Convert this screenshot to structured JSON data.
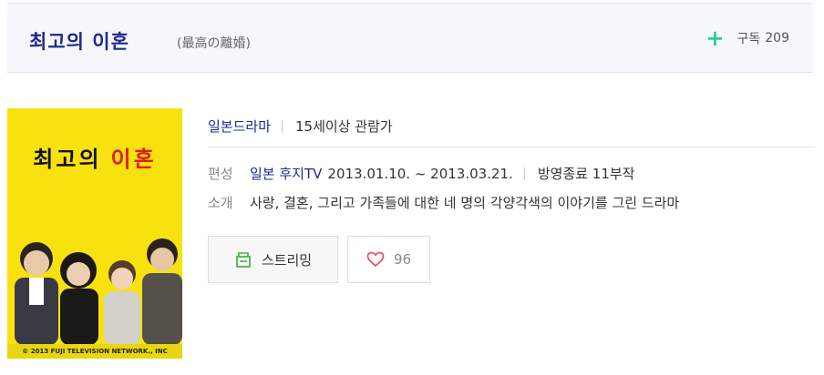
{
  "header": {
    "title": "최고의 이혼",
    "subtitle": "(最高の離婚)",
    "subscribe_label": "구독",
    "subscribe_count": "209"
  },
  "poster": {
    "title_part1": "최고의",
    "title_part2": "이혼",
    "copyright": "© 2013 FUJI TELEVISION NETWORK., INC"
  },
  "info": {
    "genre": "일본드라마",
    "age_rating": "15세이상 관람가",
    "schedule_label": "편성",
    "broadcaster": "일본 후지TV",
    "date_range": "2013.01.10. ~ 2013.03.21.",
    "status": "방영종료 11부작",
    "synopsis_label": "소개",
    "synopsis": "사랑, 결혼, 그리고 가족들에 대한 네 명의 각양각색의 이야기를 그린 드라마"
  },
  "actions": {
    "stream_label": "스트리밍",
    "like_count": "96"
  },
  "colors": {
    "title": "#1f2a8c",
    "accent_plus": "#2fc6a5",
    "stream_icon": "#48b348",
    "heart": "#e05a6a",
    "poster_bg": "#f7e20f"
  }
}
